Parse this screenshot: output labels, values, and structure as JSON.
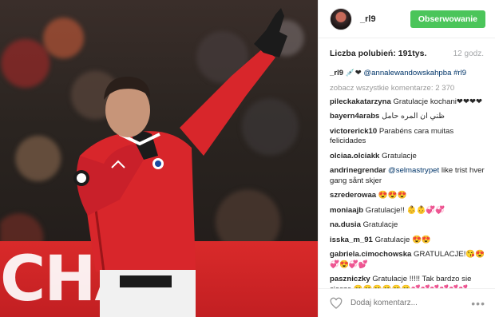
{
  "post": {
    "banner_text": "CHAN",
    "username": "_rl9",
    "follow_label": "Obserwowanie",
    "likes_label": "Liczba polubień: 191tys.",
    "time": "12 godz.",
    "caption_user": "_rl9",
    "caption_icons": "💉❤",
    "caption_mention": "@annalewandowskahpba #rl9",
    "view_all": "zobacz wszystkie komentarze: 2 370",
    "comments": [
      {
        "user": "pileckakatarzyna",
        "text": "Gratulacje kochani❤❤❤❤"
      },
      {
        "user": "bayern4arabs",
        "text": "ظني ان المره حامل"
      },
      {
        "user": "victorerick10",
        "text": "Parabéns cara muitas felicidades"
      },
      {
        "user": "olciaa.olciakk",
        "text": "Gratulacje"
      },
      {
        "user": "andrinegrendar",
        "text_mention": "@selmastrypet",
        "text": " like trist hver gang sånt skjer"
      },
      {
        "user": "szrederowaa",
        "text": "😍😍😍"
      },
      {
        "user": "moniaajb",
        "text": "Gratulacje!! 👶👶💞💞"
      },
      {
        "user": "na.dusia",
        "text": "Gratulacje"
      },
      {
        "user": "isska_m_91",
        "text": "Gratulacje 😍😍"
      },
      {
        "user": "gabriela.cimochowska",
        "text": "GRATULACJE!😘😍💞😍💞💕"
      },
      {
        "user": "paszniczky",
        "text": "Gratulacje !!!!! Tak bardzo sie cieszę 😊😊😊😊😊😊💕💕💕💕💕💕"
      }
    ],
    "add_comment_placeholder": "Dodaj komentarz...",
    "more": "•••"
  },
  "colors": {
    "follow": "#4bc55a",
    "jersey": "#d8262b",
    "mention": "#003569"
  },
  "icons": {
    "heart": "heart-outline-icon",
    "more": "more-options-icon"
  }
}
